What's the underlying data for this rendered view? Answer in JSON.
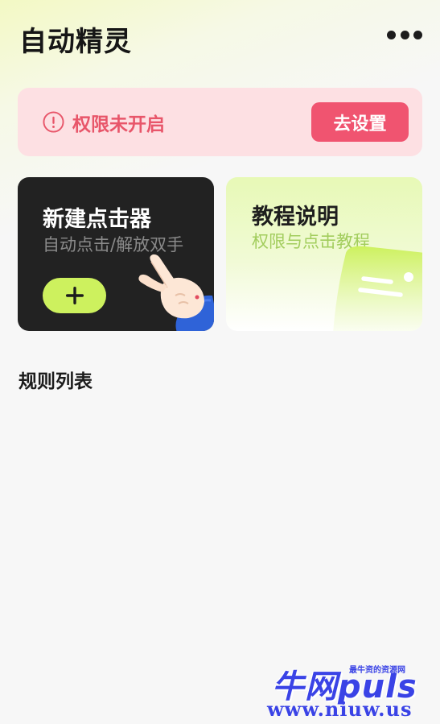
{
  "header": {
    "title": "自动精灵",
    "more_icon": "more-dots-icon"
  },
  "permission_banner": {
    "icon": "alert-circle-icon",
    "text": "权限未开启",
    "button_label": "去设置",
    "colors": {
      "background": "#fde0e3",
      "text": "#e8566a",
      "button": "#f05470"
    }
  },
  "cards": {
    "new_clicker": {
      "title": "新建点击器",
      "subtitle": "自动点击/解放双手",
      "add_icon": "plus-icon",
      "illustration": "pointing-hand-icon",
      "colors": {
        "background": "#222222",
        "accent": "#cdf15e"
      }
    },
    "tutorial": {
      "title": "教程说明",
      "subtitle": "权限与点击教程",
      "illustration": "mascot-face-icon",
      "colors": {
        "background": "#e7f9b6",
        "subtitle": "#a2cd5d"
      }
    }
  },
  "rules": {
    "section_title": "规则列表",
    "items": []
  },
  "watermark": {
    "brand": "牛网puls",
    "tagline": "最牛资的资源网",
    "url": "www.niuw.us"
  }
}
